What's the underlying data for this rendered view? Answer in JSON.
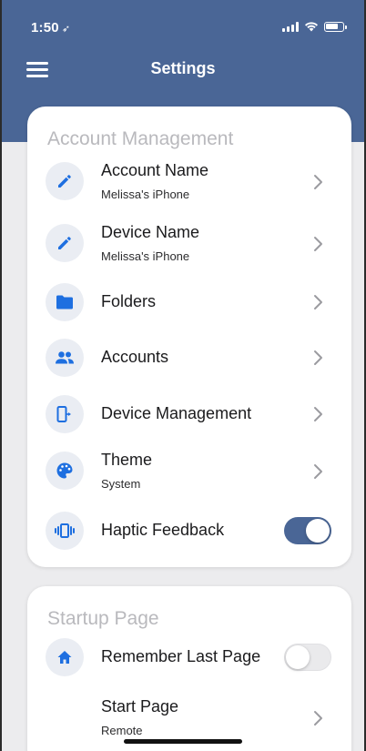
{
  "status_bar": {
    "time": "1:50",
    "location_glyph": "➶"
  },
  "navbar": {
    "title": "Settings",
    "menu_icon": "hamburger-icon"
  },
  "colors": {
    "header": "#4a6696",
    "accent": "#1e6fe0",
    "icon_bg": "#eaedf3",
    "section_title": "#b9b9bd",
    "background": "#ececee"
  },
  "account_management": {
    "title": "Account Management",
    "items": [
      {
        "label": "Account Name",
        "sub": "Melissa's iPhone",
        "icon": "pencil-icon"
      },
      {
        "label": "Device Name",
        "sub": "Melissa's iPhone",
        "icon": "pencil-icon"
      },
      {
        "label": "Folders",
        "icon": "folder-icon"
      },
      {
        "label": "Accounts",
        "icon": "people-icon"
      },
      {
        "label": "Device Management",
        "icon": "device-transfer-icon"
      },
      {
        "label": "Theme",
        "sub": "System",
        "icon": "palette-icon"
      },
      {
        "label": "Haptic Feedback",
        "icon": "vibration-icon",
        "toggle": true
      }
    ]
  },
  "startup_page": {
    "title": "Startup Page",
    "items": [
      {
        "label": "Remember Last Page",
        "icon": "home-icon",
        "toggle": false
      },
      {
        "label": "Start Page",
        "sub": "Remote"
      }
    ]
  }
}
